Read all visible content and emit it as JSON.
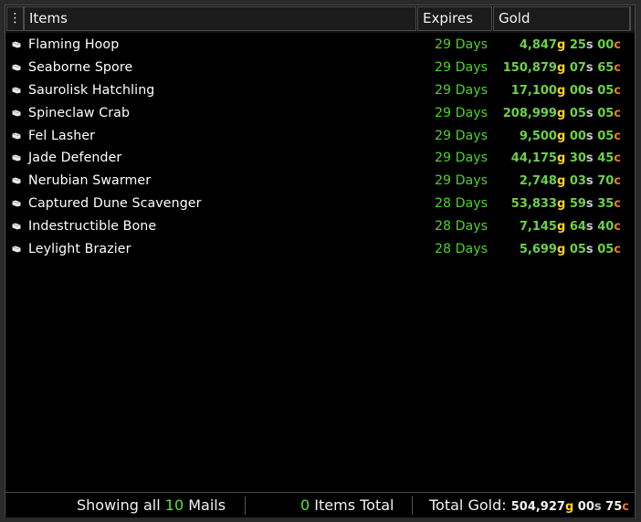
{
  "header": {
    "menu_icon": "vertical-dots-icon",
    "col_items": "Items",
    "col_expires": "Expires",
    "col_gold": "Gold"
  },
  "colors": {
    "expires": "#4fd22c",
    "gold_unit": "#ffd21f",
    "silver_unit": "#c8c8c8",
    "copper_unit": "#ea7b2a",
    "value": "#6ed04a"
  },
  "rows": [
    {
      "icon": "mail-icon",
      "name": "Flaming Hoop",
      "expires": "29 Days",
      "g": "4,847",
      "s": "25",
      "c": "00"
    },
    {
      "icon": "mail-icon",
      "name": "Seaborne Spore",
      "expires": "29 Days",
      "g": "150,879",
      "s": "07",
      "c": "65"
    },
    {
      "icon": "mail-icon",
      "name": "Saurolisk Hatchling",
      "expires": "29 Days",
      "g": "17,100",
      "s": "00",
      "c": "05"
    },
    {
      "icon": "mail-icon",
      "name": "Spineclaw Crab",
      "expires": "29 Days",
      "g": "208,999",
      "s": "05",
      "c": "05"
    },
    {
      "icon": "mail-icon",
      "name": "Fel Lasher",
      "expires": "29 Days",
      "g": "9,500",
      "s": "00",
      "c": "05"
    },
    {
      "icon": "mail-icon",
      "name": "Jade Defender",
      "expires": "29 Days",
      "g": "44,175",
      "s": "30",
      "c": "45"
    },
    {
      "icon": "mail-icon",
      "name": "Nerubian Swarmer",
      "expires": "29 Days",
      "g": "2,748",
      "s": "03",
      "c": "70"
    },
    {
      "icon": "mail-icon",
      "name": "Captured Dune Scavenger",
      "expires": "28 Days",
      "g": "53,833",
      "s": "59",
      "c": "35"
    },
    {
      "icon": "mail-icon",
      "name": "Indestructible Bone",
      "expires": "28 Days",
      "g": "7,145",
      "s": "64",
      "c": "40"
    },
    {
      "icon": "mail-icon",
      "name": "Leylight Brazier",
      "expires": "28 Days",
      "g": "5,699",
      "s": "05",
      "c": "05"
    }
  ],
  "units": {
    "g": "g",
    "s": "s",
    "c": "c"
  },
  "footer": {
    "showing_prefix": "Showing all",
    "mail_count": "10",
    "showing_suffix": "Mails",
    "items_count": "0",
    "items_suffix": "Items Total",
    "total_label": "Total Gold:",
    "total_g": "504,927",
    "total_s": "00",
    "total_c": "75"
  }
}
